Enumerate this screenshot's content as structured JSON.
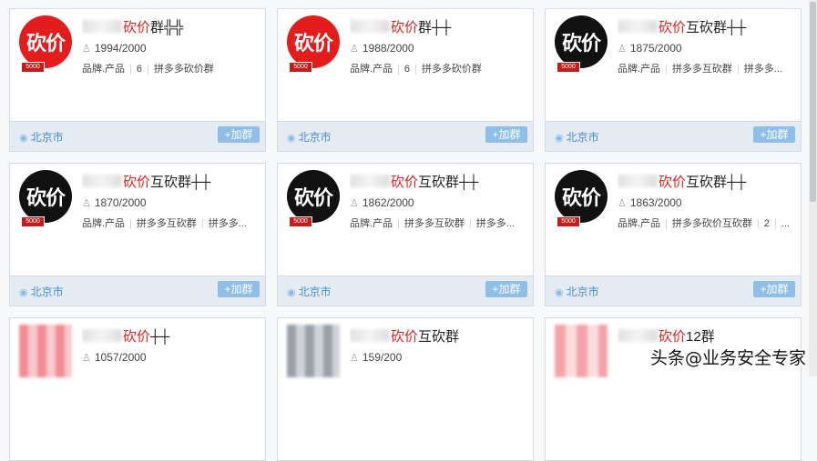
{
  "cards": [
    {
      "avatar": "砍价",
      "style": "red",
      "badge": "5000",
      "title_accent": "砍价",
      "title_rest": "群╬╬",
      "members": "1994/2000",
      "tags": [
        "品牌.产品",
        "6",
        "拼多多砍价群"
      ],
      "location": "北京市",
      "join": "+加群"
    },
    {
      "avatar": "砍价",
      "style": "red",
      "badge": "5000",
      "title_accent": "砍价",
      "title_rest": "群┼┼",
      "members": "1988/2000",
      "tags": [
        "品牌.产品",
        "6",
        "拼多多砍价群"
      ],
      "location": "北京市",
      "join": "+加群"
    },
    {
      "avatar": "砍价",
      "style": "black",
      "badge": "5000",
      "title_accent": "砍价",
      "title_rest": "互砍群┼┼",
      "members": "1875/2000",
      "tags": [
        "品牌.产品",
        "拼多多互砍群",
        "拼多多..."
      ],
      "location": "北京市",
      "join": "+加群"
    },
    {
      "avatar": "砍价",
      "style": "black",
      "badge": "5000",
      "title_accent": "砍价",
      "title_rest": "互砍群┼┼",
      "members": "1870/2000",
      "tags": [
        "品牌.产品",
        "拼多多互砍群",
        "拼多多..."
      ],
      "location": "北京市",
      "join": "+加群"
    },
    {
      "avatar": "砍价",
      "style": "black",
      "badge": "5000",
      "title_accent": "砍价",
      "title_rest": "互砍群┼┼",
      "members": "1862/2000",
      "tags": [
        "品牌.产品",
        "拼多多互砍群",
        "拼多多..."
      ],
      "location": "北京市",
      "join": "+加群"
    },
    {
      "avatar": "砍价",
      "style": "black",
      "badge": "5000",
      "title_accent": "砍价",
      "title_rest": "互砍群┼┼",
      "members": "1863/2000",
      "tags": [
        "品牌.产品",
        "拼多多砍价互砍群",
        "2",
        "..."
      ],
      "location": "北京市",
      "join": "+加群"
    },
    {
      "avatar": "",
      "style": "blur pink",
      "badge": "",
      "title_accent": "砍价",
      "title_rest": "┼┼",
      "members": "1057/2000",
      "tags": [],
      "location": "",
      "join": ""
    },
    {
      "avatar": "",
      "style": "blur gray",
      "badge": "",
      "title_accent": "砍价",
      "title_rest": "互砍群",
      "members": "159/200",
      "tags": [],
      "location": "",
      "join": ""
    },
    {
      "avatar": "",
      "style": "blur rose",
      "badge": "",
      "title_accent": "砍价",
      "title_rest": "12群",
      "members": "",
      "tags": [],
      "location": "",
      "join": ""
    }
  ],
  "watermark": "头条@业务安全专家",
  "icons": {
    "members": "people-icon",
    "location": "map-pin-icon"
  }
}
